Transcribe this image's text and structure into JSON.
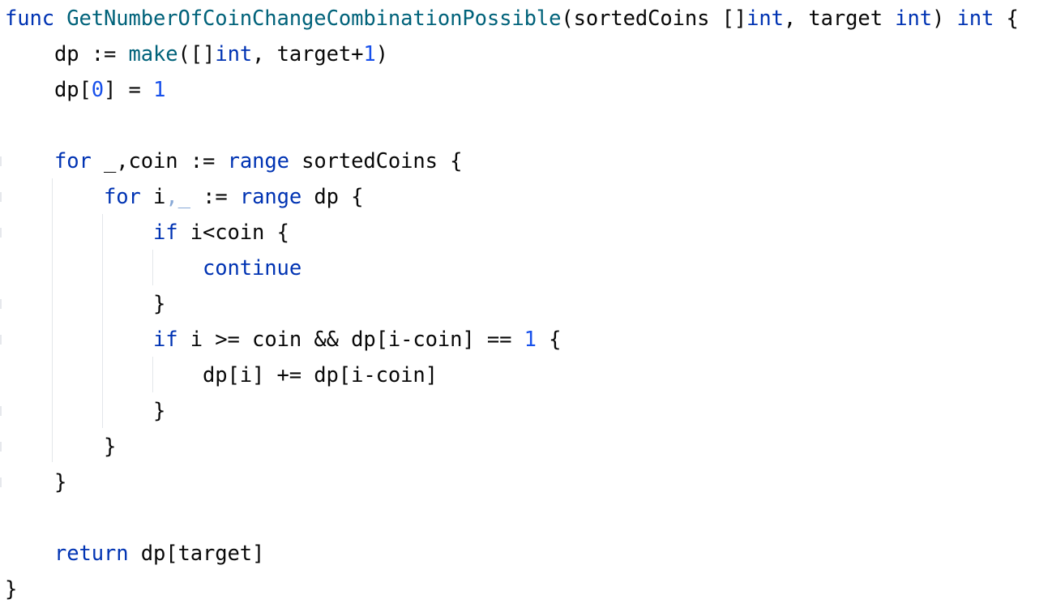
{
  "editor": {
    "lines": [
      [
        {
          "t": "func ",
          "k": "kw"
        },
        {
          "t": "GetNumberOfCoinChangeCombinationPossible",
          "k": "fn"
        },
        {
          "t": "(sortedCoins []",
          "k": "plain"
        },
        {
          "t": "int",
          "k": "kw"
        },
        {
          "t": ", target ",
          "k": "plain"
        },
        {
          "t": "int",
          "k": "kw"
        },
        {
          "t": ") ",
          "k": "plain"
        },
        {
          "t": "int",
          "k": "kw"
        },
        {
          "t": " {",
          "k": "plain"
        }
      ],
      [
        {
          "t": "    dp := ",
          "k": "plain"
        },
        {
          "t": "make",
          "k": "fn"
        },
        {
          "t": "([]",
          "k": "plain"
        },
        {
          "t": "int",
          "k": "kw"
        },
        {
          "t": ", target+",
          "k": "plain"
        },
        {
          "t": "1",
          "k": "num"
        },
        {
          "t": ")",
          "k": "plain"
        }
      ],
      [
        {
          "t": "    dp[",
          "k": "plain"
        },
        {
          "t": "0",
          "k": "num"
        },
        {
          "t": "] = ",
          "k": "plain"
        },
        {
          "t": "1",
          "k": "num"
        }
      ],
      [],
      [
        {
          "t": "    ",
          "k": "plain"
        },
        {
          "t": "for",
          "k": "kw"
        },
        {
          "t": " _,coin := ",
          "k": "plain"
        },
        {
          "t": "range",
          "k": "kw"
        },
        {
          "t": " sortedCoins {",
          "k": "plain"
        }
      ],
      [
        {
          "t": "        ",
          "k": "plain"
        },
        {
          "t": "for",
          "k": "kw"
        },
        {
          "t": " i",
          "k": "plain"
        },
        {
          "t": ",_",
          "k": "faded"
        },
        {
          "t": " := ",
          "k": "plain"
        },
        {
          "t": "range",
          "k": "kw"
        },
        {
          "t": " dp {",
          "k": "plain"
        }
      ],
      [
        {
          "t": "            ",
          "k": "plain"
        },
        {
          "t": "if",
          "k": "kw"
        },
        {
          "t": " i<coin {",
          "k": "plain"
        }
      ],
      [
        {
          "t": "                ",
          "k": "plain"
        },
        {
          "t": "continue",
          "k": "kw"
        }
      ],
      [
        {
          "t": "            }",
          "k": "plain"
        }
      ],
      [
        {
          "t": "            ",
          "k": "plain"
        },
        {
          "t": "if",
          "k": "kw"
        },
        {
          "t": " i >= coin && dp[i-coin] == ",
          "k": "plain"
        },
        {
          "t": "1",
          "k": "num"
        },
        {
          "t": " {",
          "k": "plain"
        }
      ],
      [
        {
          "t": "                dp[i] += dp[i-coin]",
          "k": "plain"
        }
      ],
      [
        {
          "t": "            }",
          "k": "plain"
        }
      ],
      [
        {
          "t": "        }",
          "k": "plain"
        }
      ],
      [
        {
          "t": "    }",
          "k": "plain"
        }
      ],
      [],
      [
        {
          "t": "    ",
          "k": "plain"
        },
        {
          "t": "return",
          "k": "kw"
        },
        {
          "t": " dp[target]",
          "k": "plain"
        }
      ],
      [
        {
          "t": "}",
          "k": "plain"
        }
      ]
    ]
  },
  "colors": {
    "keyword": "#0033b3",
    "function": "#00627a",
    "number": "#1750eb",
    "text": "#080808",
    "unused_variable": "#87a8d6",
    "indent_guide": "#e3e6ea",
    "background": "#ffffff"
  }
}
